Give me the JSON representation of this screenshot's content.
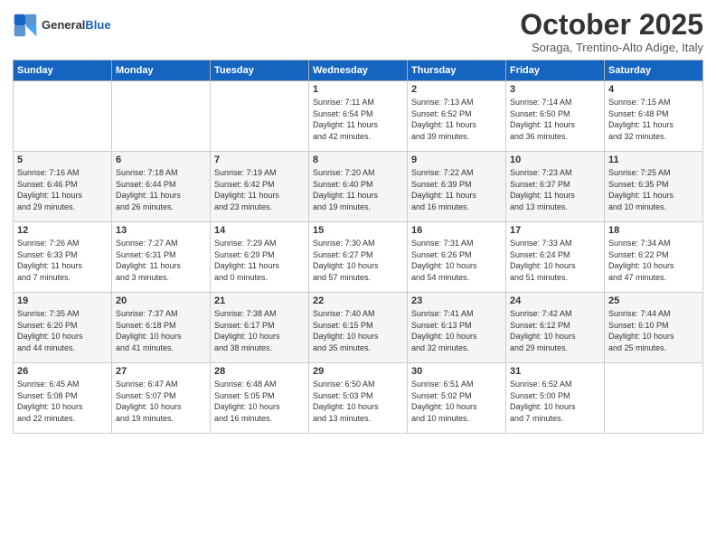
{
  "header": {
    "logo_line1": "General",
    "logo_line2": "Blue",
    "month_title": "October 2025",
    "subtitle": "Soraga, Trentino-Alto Adige, Italy"
  },
  "weekdays": [
    "Sunday",
    "Monday",
    "Tuesday",
    "Wednesday",
    "Thursday",
    "Friday",
    "Saturday"
  ],
  "weeks": [
    [
      {
        "day": "",
        "info": ""
      },
      {
        "day": "",
        "info": ""
      },
      {
        "day": "",
        "info": ""
      },
      {
        "day": "1",
        "info": "Sunrise: 7:11 AM\nSunset: 6:54 PM\nDaylight: 11 hours\nand 42 minutes."
      },
      {
        "day": "2",
        "info": "Sunrise: 7:13 AM\nSunset: 6:52 PM\nDaylight: 11 hours\nand 39 minutes."
      },
      {
        "day": "3",
        "info": "Sunrise: 7:14 AM\nSunset: 6:50 PM\nDaylight: 11 hours\nand 36 minutes."
      },
      {
        "day": "4",
        "info": "Sunrise: 7:15 AM\nSunset: 6:48 PM\nDaylight: 11 hours\nand 32 minutes."
      }
    ],
    [
      {
        "day": "5",
        "info": "Sunrise: 7:16 AM\nSunset: 6:46 PM\nDaylight: 11 hours\nand 29 minutes."
      },
      {
        "day": "6",
        "info": "Sunrise: 7:18 AM\nSunset: 6:44 PM\nDaylight: 11 hours\nand 26 minutes."
      },
      {
        "day": "7",
        "info": "Sunrise: 7:19 AM\nSunset: 6:42 PM\nDaylight: 11 hours\nand 23 minutes."
      },
      {
        "day": "8",
        "info": "Sunrise: 7:20 AM\nSunset: 6:40 PM\nDaylight: 11 hours\nand 19 minutes."
      },
      {
        "day": "9",
        "info": "Sunrise: 7:22 AM\nSunset: 6:39 PM\nDaylight: 11 hours\nand 16 minutes."
      },
      {
        "day": "10",
        "info": "Sunrise: 7:23 AM\nSunset: 6:37 PM\nDaylight: 11 hours\nand 13 minutes."
      },
      {
        "day": "11",
        "info": "Sunrise: 7:25 AM\nSunset: 6:35 PM\nDaylight: 11 hours\nand 10 minutes."
      }
    ],
    [
      {
        "day": "12",
        "info": "Sunrise: 7:26 AM\nSunset: 6:33 PM\nDaylight: 11 hours\nand 7 minutes."
      },
      {
        "day": "13",
        "info": "Sunrise: 7:27 AM\nSunset: 6:31 PM\nDaylight: 11 hours\nand 3 minutes."
      },
      {
        "day": "14",
        "info": "Sunrise: 7:29 AM\nSunset: 6:29 PM\nDaylight: 11 hours\nand 0 minutes."
      },
      {
        "day": "15",
        "info": "Sunrise: 7:30 AM\nSunset: 6:27 PM\nDaylight: 10 hours\nand 57 minutes."
      },
      {
        "day": "16",
        "info": "Sunrise: 7:31 AM\nSunset: 6:26 PM\nDaylight: 10 hours\nand 54 minutes."
      },
      {
        "day": "17",
        "info": "Sunrise: 7:33 AM\nSunset: 6:24 PM\nDaylight: 10 hours\nand 51 minutes."
      },
      {
        "day": "18",
        "info": "Sunrise: 7:34 AM\nSunset: 6:22 PM\nDaylight: 10 hours\nand 47 minutes."
      }
    ],
    [
      {
        "day": "19",
        "info": "Sunrise: 7:35 AM\nSunset: 6:20 PM\nDaylight: 10 hours\nand 44 minutes."
      },
      {
        "day": "20",
        "info": "Sunrise: 7:37 AM\nSunset: 6:18 PM\nDaylight: 10 hours\nand 41 minutes."
      },
      {
        "day": "21",
        "info": "Sunrise: 7:38 AM\nSunset: 6:17 PM\nDaylight: 10 hours\nand 38 minutes."
      },
      {
        "day": "22",
        "info": "Sunrise: 7:40 AM\nSunset: 6:15 PM\nDaylight: 10 hours\nand 35 minutes."
      },
      {
        "day": "23",
        "info": "Sunrise: 7:41 AM\nSunset: 6:13 PM\nDaylight: 10 hours\nand 32 minutes."
      },
      {
        "day": "24",
        "info": "Sunrise: 7:42 AM\nSunset: 6:12 PM\nDaylight: 10 hours\nand 29 minutes."
      },
      {
        "day": "25",
        "info": "Sunrise: 7:44 AM\nSunset: 6:10 PM\nDaylight: 10 hours\nand 25 minutes."
      }
    ],
    [
      {
        "day": "26",
        "info": "Sunrise: 6:45 AM\nSunset: 5:08 PM\nDaylight: 10 hours\nand 22 minutes."
      },
      {
        "day": "27",
        "info": "Sunrise: 6:47 AM\nSunset: 5:07 PM\nDaylight: 10 hours\nand 19 minutes."
      },
      {
        "day": "28",
        "info": "Sunrise: 6:48 AM\nSunset: 5:05 PM\nDaylight: 10 hours\nand 16 minutes."
      },
      {
        "day": "29",
        "info": "Sunrise: 6:50 AM\nSunset: 5:03 PM\nDaylight: 10 hours\nand 13 minutes."
      },
      {
        "day": "30",
        "info": "Sunrise: 6:51 AM\nSunset: 5:02 PM\nDaylight: 10 hours\nand 10 minutes."
      },
      {
        "day": "31",
        "info": "Sunrise: 6:52 AM\nSunset: 5:00 PM\nDaylight: 10 hours\nand 7 minutes."
      },
      {
        "day": "",
        "info": ""
      }
    ]
  ]
}
